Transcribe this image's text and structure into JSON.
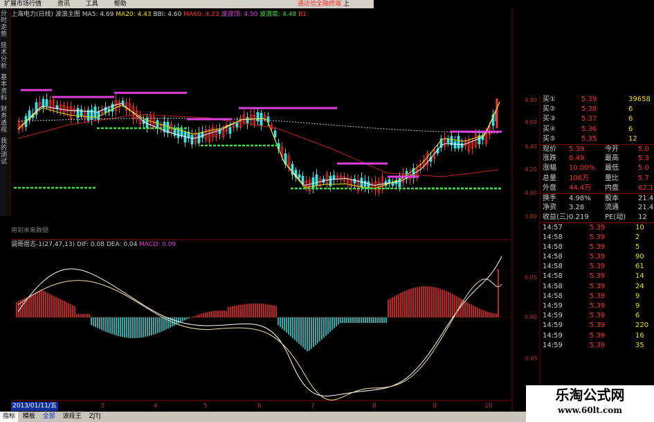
{
  "menu": [
    "扩展市场行情",
    "资讯",
    "工具",
    "帮助"
  ],
  "ad_text": "通达信全融终端",
  "ad_extra": "上",
  "left_nav": [
    "分时走势",
    "技术分析",
    "基本资料",
    "财务透视",
    "我的测试"
  ],
  "title": {
    "stock": "上海电力(日线)",
    "indicator": "波浪主图",
    "ma5": "MA5: 4.69",
    "ma20": "MA20: 4.43",
    "bbi": "BBI: 4.60",
    "ma60": "MA60: 4.23",
    "top_label": "波浪顶: 4.50",
    "bottom_label": "波浪底: 4.48",
    "b_label": "B1"
  },
  "future_note": "用到未来数据",
  "macd_title": {
    "name": "调哥煜志-1(27,47,13)",
    "dif": "DIF: 0.08",
    "dea": "DEA: 0.04",
    "macd": "MACD: 0.09"
  },
  "y_axis_price": [
    "4.80",
    "4.60",
    "4.40",
    "4.20",
    "4.00",
    "3.80"
  ],
  "y_axis_macd": [
    "0.05",
    "0.00",
    "-0.05"
  ],
  "x_axis": [
    "3",
    "4",
    "5",
    "6",
    "7",
    "8",
    "9",
    "10"
  ],
  "date_label": "2013/01/11/五",
  "quote": {
    "buy": [
      {
        "label": "买①",
        "price": "5.39",
        "vol": "39658"
      },
      {
        "label": "买②",
        "price": "5.38",
        "vol": "6"
      },
      {
        "label": "买③",
        "price": "5.37",
        "vol": "6"
      },
      {
        "label": "买④",
        "price": "5.36",
        "vol": "6"
      },
      {
        "label": "买⑤",
        "price": "5.35",
        "vol": "12"
      }
    ],
    "stats": [
      {
        "l1": "现价",
        "v1": "5.39",
        "l2": "今开",
        "v2": "5.0"
      },
      {
        "l1": "涨跌",
        "v1": "0.49",
        "l2": "最高",
        "v2": "5.3"
      },
      {
        "l1": "涨幅",
        "v1": "10.00%",
        "l2": "最低",
        "v2": "5.0"
      },
      {
        "l1": "总量",
        "v1": "106万",
        "l2": "量比",
        "v2": "5.7"
      },
      {
        "l1": "外盘",
        "v1": "44.4万",
        "l2": "内盘",
        "v2": "62.1"
      },
      {
        "l1": "换手",
        "v1": "4.98%",
        "l2": "股本",
        "v2": "21.4"
      },
      {
        "l1": "净资",
        "v1": "3.28",
        "l2": "流通",
        "v2": "21.4"
      },
      {
        "l1": "收益(三)",
        "v1": "0.219",
        "l2": "PE(动)",
        "v2": "12"
      }
    ],
    "ticks": [
      {
        "t": "14:57",
        "p": "5.39",
        "v": "10"
      },
      {
        "t": "14:58",
        "p": "5.39",
        "v": "2"
      },
      {
        "t": "14:58",
        "p": "5.39",
        "v": "5"
      },
      {
        "t": "14:58",
        "p": "5.39",
        "v": "90"
      },
      {
        "t": "14:58",
        "p": "5.39",
        "v": "61"
      },
      {
        "t": "14:58",
        "p": "5.39",
        "v": "14"
      },
      {
        "t": "14:58",
        "p": "5.39",
        "v": "24"
      },
      {
        "t": "14:58",
        "p": "5.39",
        "v": "9"
      },
      {
        "t": "14:59",
        "p": "5.39",
        "v": "9"
      },
      {
        "t": "14:59",
        "p": "5.39",
        "v": "6"
      },
      {
        "t": "14:59",
        "p": "5.39",
        "v": "220"
      },
      {
        "t": "14:59",
        "p": "5.39",
        "v": "16"
      },
      {
        "t": "14:59",
        "p": "5.39",
        "v": "35"
      }
    ]
  },
  "bottom_tabs": [
    "指标",
    "模板",
    "全部",
    "波段王",
    "ZJTJ"
  ],
  "watermark": {
    "line1": "乐淘公式网",
    "line2": "www.60lt.com"
  },
  "colors": {
    "up": "#ff3030",
    "down": "#40e0e0",
    "ma5": "#ffffff",
    "ma20": "#f0e000",
    "ma60": "#c02020",
    "wave_top": "#e040e0",
    "wave_bottom": "#40e040"
  }
}
